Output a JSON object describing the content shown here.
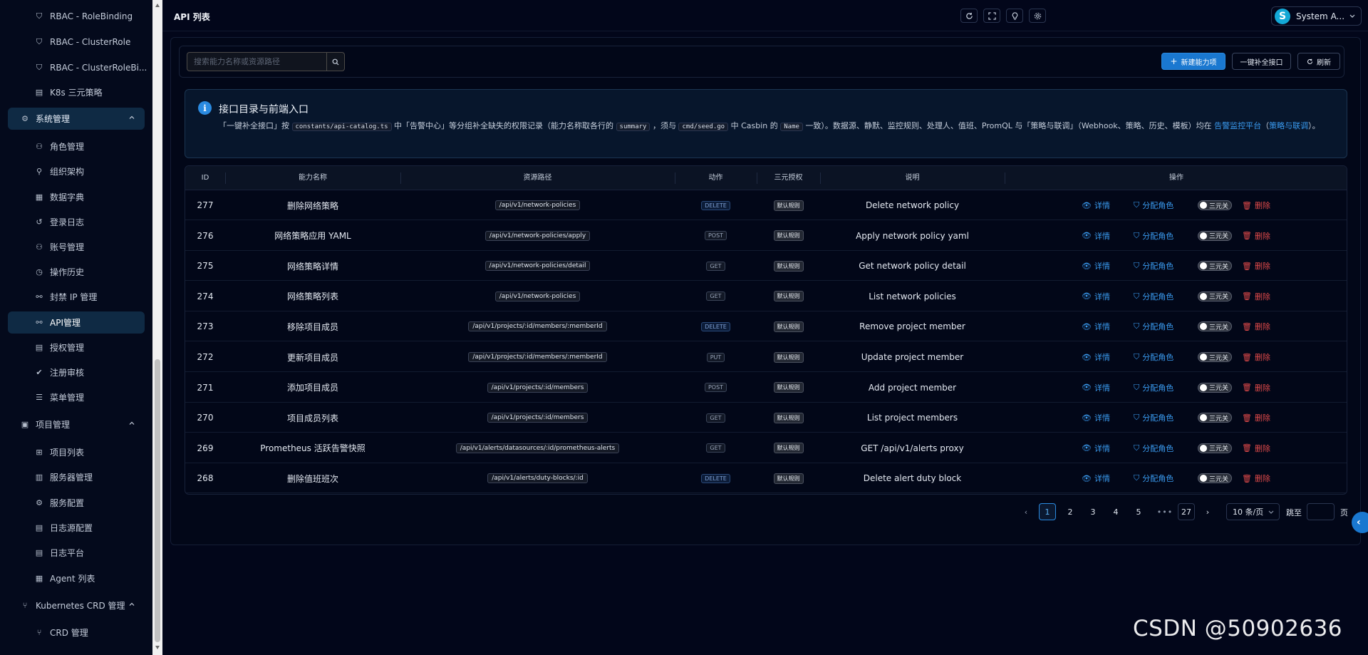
{
  "sidebar": {
    "items": [
      {
        "label": "RBAC - RoleBinding",
        "icon": "shield-icon",
        "type": "sub"
      },
      {
        "label": "RBAC - ClusterRole",
        "icon": "shield-icon",
        "type": "sub"
      },
      {
        "label": "RBAC - ClusterRoleBi...",
        "icon": "shield-icon",
        "type": "sub"
      },
      {
        "label": "K8s 三元策略",
        "icon": "document-check-icon",
        "type": "sub"
      },
      {
        "label": "系统管理",
        "icon": "gear-icon",
        "type": "group",
        "expanded": true
      },
      {
        "label": "角色管理",
        "icon": "users-icon",
        "type": "sub"
      },
      {
        "label": "组织架构",
        "icon": "org-tree-icon",
        "type": "sub"
      },
      {
        "label": "数据字典",
        "icon": "book-icon",
        "type": "sub"
      },
      {
        "label": "登录日志",
        "icon": "history-icon",
        "type": "sub"
      },
      {
        "label": "账号管理",
        "icon": "user-icon",
        "type": "sub"
      },
      {
        "label": "操作历史",
        "icon": "clock-icon",
        "type": "sub"
      },
      {
        "label": "封禁 IP 管理",
        "icon": "link-icon",
        "type": "sub"
      },
      {
        "label": "API管理",
        "icon": "link-icon",
        "type": "sub",
        "active": true
      },
      {
        "label": "授权管理",
        "icon": "document-check-icon",
        "type": "sub"
      },
      {
        "label": "注册审核",
        "icon": "check-circle-icon",
        "type": "sub"
      },
      {
        "label": "菜单管理",
        "icon": "menu-icon",
        "type": "sub"
      },
      {
        "label": "项目管理",
        "icon": "folder-icon",
        "type": "group",
        "expanded": true
      },
      {
        "label": "项目列表",
        "icon": "grid-icon",
        "type": "sub"
      },
      {
        "label": "服务器管理",
        "icon": "server-icon",
        "type": "sub"
      },
      {
        "label": "服务配置",
        "icon": "gear-icon",
        "type": "sub"
      },
      {
        "label": "日志源配置",
        "icon": "log-icon",
        "type": "sub"
      },
      {
        "label": "日志平台",
        "icon": "log-icon",
        "type": "sub"
      },
      {
        "label": "Agent 列表",
        "icon": "agent-icon",
        "type": "sub"
      },
      {
        "label": "Kubernetes CRD 管理",
        "icon": "branch-icon",
        "type": "group",
        "expanded": true
      },
      {
        "label": "CRD 管理",
        "icon": "branch-icon",
        "type": "sub"
      }
    ]
  },
  "header": {
    "title": "API 列表",
    "user_initial": "S",
    "user_name": "System A..."
  },
  "search": {
    "placeholder": "搜索能力名称或资源路径",
    "value": ""
  },
  "toolbar": {
    "new_label": "新建能力项",
    "fill_label": "一键补全接口",
    "refresh_label": "刷新"
  },
  "info": {
    "title": "接口目录与前端入口",
    "p1": "「一键补全接口」按",
    "code1": "constants/api-catalog.ts",
    "p2": "中「告警中心」等分组补全缺失的权限记录（能力名称取各行的",
    "code2": "summary",
    "p3": "，须与",
    "code3": "cmd/seed.go",
    "p4": "中 Casbin 的",
    "code4": "Name",
    "p5": "一致）。数据源、静默、监控规则、处理人、值班、PromQL 与「策略与联调」（Webhook、策略、历史、模板）均在",
    "link1": "告警监控平台",
    "p6": "（",
    "link2": "策略与联调",
    "p7": "）。"
  },
  "table": {
    "headers": {
      "id": "ID",
      "name": "能力名称",
      "path": "资源路径",
      "method": "动作",
      "auth": "三元授权",
      "desc": "说明",
      "ops": "操作"
    },
    "actions": {
      "detail": "详情",
      "assign": "分配角色",
      "toggle": "三元关",
      "delete": "删除"
    },
    "rows": [
      {
        "id": "277",
        "name": "删除网络策略",
        "path": "/api/v1/network-policies",
        "method": "DELETE",
        "auth": "默认规则",
        "desc": "Delete network policy"
      },
      {
        "id": "276",
        "name": "网络策略应用 YAML",
        "path": "/api/v1/network-policies/apply",
        "method": "POST",
        "auth": "默认规则",
        "desc": "Apply network policy yaml"
      },
      {
        "id": "275",
        "name": "网络策略详情",
        "path": "/api/v1/network-policies/detail",
        "method": "GET",
        "auth": "默认规则",
        "desc": "Get network policy detail"
      },
      {
        "id": "274",
        "name": "网络策略列表",
        "path": "/api/v1/network-policies",
        "method": "GET",
        "auth": "默认规则",
        "desc": "List network policies"
      },
      {
        "id": "273",
        "name": "移除项目成员",
        "path": "/api/v1/projects/:id/members/:memberId",
        "method": "DELETE",
        "auth": "默认规则",
        "desc": "Remove project member"
      },
      {
        "id": "272",
        "name": "更新项目成员",
        "path": "/api/v1/projects/:id/members/:memberId",
        "method": "PUT",
        "auth": "默认规则",
        "desc": "Update project member"
      },
      {
        "id": "271",
        "name": "添加项目成员",
        "path": "/api/v1/projects/:id/members",
        "method": "POST",
        "auth": "默认规则",
        "desc": "Add project member"
      },
      {
        "id": "270",
        "name": "项目成员列表",
        "path": "/api/v1/projects/:id/members",
        "method": "GET",
        "auth": "默认规则",
        "desc": "List project members"
      },
      {
        "id": "269",
        "name": "Prometheus 活跃告警快照",
        "path": "/api/v1/alerts/datasources/:id/prometheus-alerts",
        "method": "GET",
        "auth": "默认规则",
        "desc": "GET /api/v1/alerts proxy"
      },
      {
        "id": "268",
        "name": "删除值班班次",
        "path": "/api/v1/alerts/duty-blocks/:id",
        "method": "DELETE",
        "auth": "默认规则",
        "desc": "Delete alert duty block"
      }
    ]
  },
  "pagination": {
    "pages": [
      "1",
      "2",
      "3",
      "4",
      "5"
    ],
    "current": "1",
    "ellipsis": "•••",
    "last": "27",
    "page_size": "10 条/页",
    "jump_label": "跳至",
    "page_label": "页"
  },
  "watermark": "CSDN @50902636"
}
